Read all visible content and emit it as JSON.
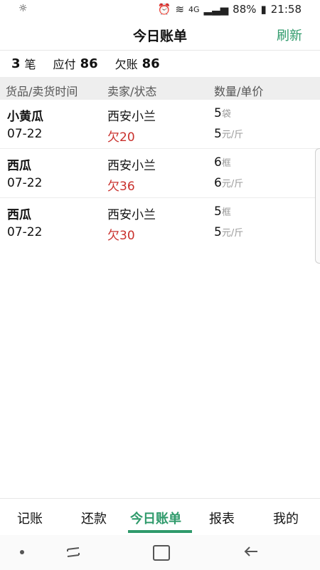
{
  "status_bar": {
    "signal_label": "4G",
    "battery": "88%",
    "time": "21:58",
    "icons": [
      "weather-icon",
      "alarm-icon",
      "wifi-icon",
      "signal-icon",
      "battery-icon"
    ]
  },
  "header": {
    "title": "今日账单",
    "refresh_label": "刷新"
  },
  "summary": {
    "count": "3",
    "count_unit": "笔",
    "payable_label": "应付",
    "payable_value": "86",
    "debt_label": "欠账",
    "debt_value": "86"
  },
  "table": {
    "headers": [
      "货品/卖货时间",
      "卖家/状态",
      "数量/单价"
    ],
    "rows": [
      {
        "product": "小黄瓜",
        "date": "07-22",
        "seller": "西安小兰",
        "status": "欠20",
        "qty": "5",
        "qty_unit": "袋",
        "price": "5",
        "price_unit": "元/斤"
      },
      {
        "product": "西瓜",
        "date": "07-22",
        "seller": "西安小兰",
        "status": "欠36",
        "qty": "6",
        "qty_unit": "框",
        "price": "6",
        "price_unit": "元/斤"
      },
      {
        "product": "西瓜",
        "date": "07-22",
        "seller": "西安小兰",
        "status": "欠30",
        "qty": "5",
        "qty_unit": "框",
        "price": "5",
        "price_unit": "元/斤"
      }
    ]
  },
  "tabbar": {
    "tabs": [
      {
        "label": "记账",
        "active": false
      },
      {
        "label": "还款",
        "active": false
      },
      {
        "label": "今日账单",
        "active": true
      },
      {
        "label": "报表",
        "active": false
      },
      {
        "label": "我的",
        "active": false
      }
    ]
  },
  "colors": {
    "accent": "#2f9a6b",
    "debt": "#c9302c",
    "header_bg": "#eeeeee"
  }
}
